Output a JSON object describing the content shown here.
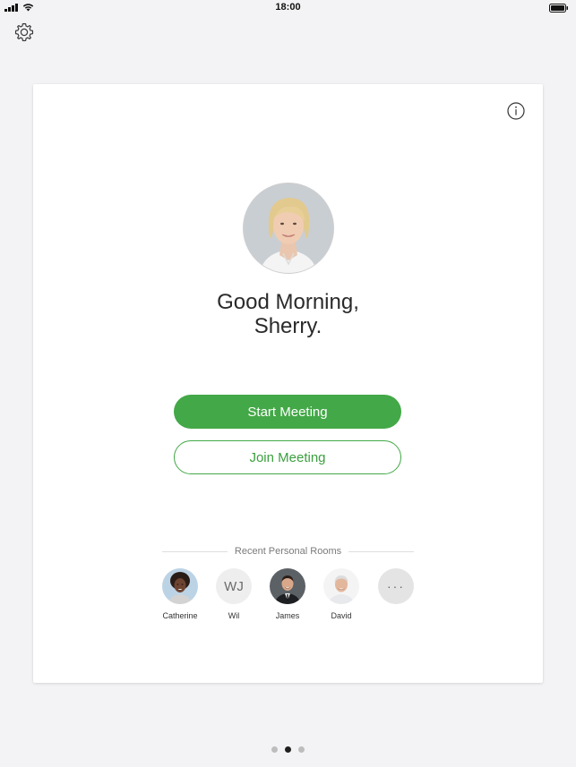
{
  "status_bar": {
    "time": "18:00"
  },
  "card": {
    "greeting_line1": "Good Morning,",
    "greeting_line2": "Sherry.",
    "start_button": "Start Meeting",
    "join_button": "Join Meeting",
    "recent_header": "Recent Personal Rooms",
    "rooms": [
      {
        "name": "Catherine",
        "type": "photo"
      },
      {
        "name": "Wil",
        "initials": "WJ",
        "type": "initials"
      },
      {
        "name": "James",
        "type": "photo"
      },
      {
        "name": "David",
        "type": "photo"
      },
      {
        "name": "",
        "label": "···",
        "type": "more"
      }
    ]
  },
  "pagination": {
    "count": 3,
    "active": 2
  },
  "colors": {
    "accent": "#43a847",
    "background": "#f3f3f5",
    "card": "#ffffff"
  }
}
